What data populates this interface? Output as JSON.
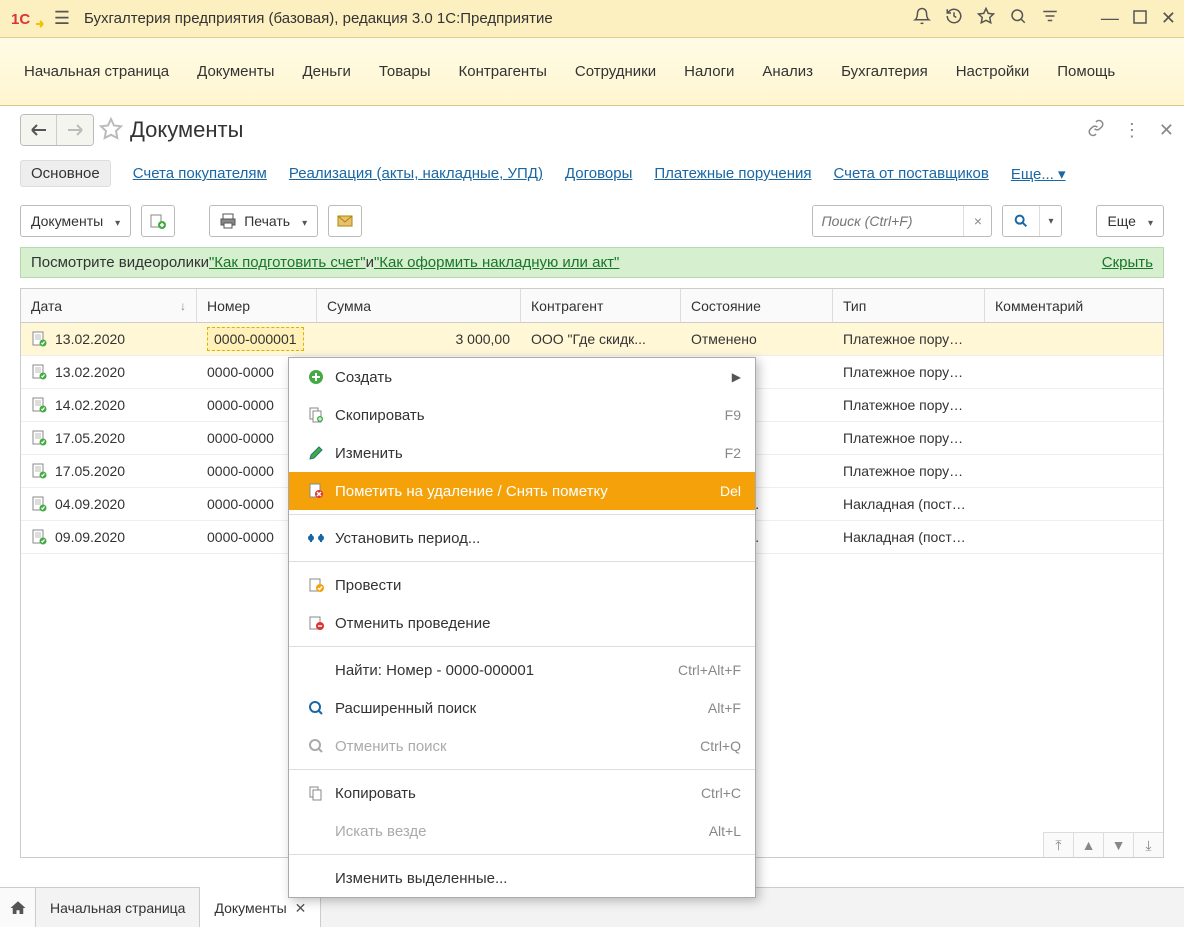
{
  "titlebar": {
    "app_title": "Бухгалтерия предприятия (базовая), редакция 3.0 1С:Предприятие"
  },
  "sections": [
    "Начальная страница",
    "Документы",
    "Деньги",
    "Товары",
    "Контрагенты",
    "Сотрудники",
    "Налоги",
    "Анализ",
    "Бухгалтерия",
    "Настройки",
    "Помощь"
  ],
  "page": {
    "title": "Документы"
  },
  "cmdbar": {
    "main_tab": "Основное",
    "links": [
      "Счета покупателям",
      "Реализация (акты, накладные, УПД)",
      "Договоры",
      "Платежные поручения",
      "Счета от поставщиков"
    ],
    "more": "Еще..."
  },
  "toolbar": {
    "documents": "Документы",
    "print": "Печать",
    "search_placeholder": "Поиск (Ctrl+F)",
    "more": "Еще"
  },
  "tip": {
    "prefix": "Посмотрите видеоролики ",
    "link1": "\"Как подготовить счет\"",
    "mid": " и ",
    "link2": "\"Как оформить накладную или акт\"",
    "hide": "Скрыть"
  },
  "columns": {
    "date": "Дата",
    "number": "Номер",
    "sum": "Сумма",
    "cagent": "Контрагент",
    "state": "Состояние",
    "type": "Тип",
    "comment": "Комментарий"
  },
  "rows": [
    {
      "date": "13.02.2020",
      "number": "0000-000001",
      "sum": "3 000,00",
      "cagent": "ООО \"Где скидк...",
      "state": "Отменено",
      "type": "Платежное пору…"
    },
    {
      "date": "13.02.2020",
      "number": "0000-0000",
      "sum": "",
      "cagent": "",
      "state": "",
      "type": "Платежное пору…"
    },
    {
      "date": "14.02.2020",
      "number": "0000-0000",
      "sum": "",
      "cagent": "",
      "state": "о",
      "type": "Платежное пору…"
    },
    {
      "date": "17.05.2020",
      "number": "0000-0000",
      "sum": "",
      "cagent": "",
      "state": "ено",
      "type": "Платежное пору…"
    },
    {
      "date": "17.05.2020",
      "number": "0000-0000",
      "sum": "",
      "cagent": "",
      "state": "ено",
      "type": "Платежное пору…"
    },
    {
      "date": "04.09.2020",
      "number": "0000-0000",
      "sum": "",
      "cagent": "",
      "state": "л не пол…",
      "type": "Накладная (пост…"
    },
    {
      "date": "09.09.2020",
      "number": "0000-0000",
      "sum": "",
      "cagent": "",
      "state": "л не пол…",
      "type": "Накладная (пост…"
    }
  ],
  "context_menu": [
    {
      "icon": "plus-circle",
      "label": "Создать",
      "kbd": "",
      "arrow": true,
      "sep_after": false
    },
    {
      "icon": "copy-doc",
      "label": "Скопировать",
      "kbd": "F9"
    },
    {
      "icon": "pencil",
      "label": "Изменить",
      "kbd": "F2"
    },
    {
      "icon": "mark-delete",
      "label": "Пометить на удаление / Снять пометку",
      "kbd": "Del",
      "highlight": true,
      "sep_after": true
    },
    {
      "icon": "period",
      "label": "Установить период...",
      "kbd": "",
      "sep_after": true
    },
    {
      "icon": "post",
      "label": "Провести",
      "kbd": ""
    },
    {
      "icon": "unpost",
      "label": "Отменить проведение",
      "kbd": "",
      "sep_after": true
    },
    {
      "icon": "",
      "label": "Найти: Номер - 0000-000001",
      "kbd": "Ctrl+Alt+F"
    },
    {
      "icon": "search",
      "label": "Расширенный поиск",
      "kbd": "Alt+F"
    },
    {
      "icon": "search-cancel",
      "label": "Отменить поиск",
      "kbd": "Ctrl+Q",
      "disabled": true,
      "sep_after": true
    },
    {
      "icon": "copy",
      "label": "Копировать",
      "kbd": "Ctrl+C"
    },
    {
      "icon": "",
      "label": "Искать везде",
      "kbd": "Alt+L",
      "disabled": true,
      "sep_after": true
    },
    {
      "icon": "",
      "label": "Изменить выделенные...",
      "kbd": ""
    }
  ],
  "tabs": {
    "home": "Начальная страница",
    "doc": "Документы"
  }
}
